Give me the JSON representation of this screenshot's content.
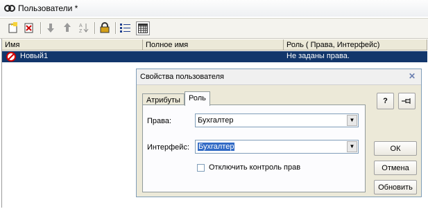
{
  "window": {
    "title": "Пользователи *"
  },
  "toolbar": {
    "icons": [
      "new-user-icon",
      "delete-user-icon",
      "move-down-icon",
      "move-up-icon",
      "sort-icon",
      "lock-icon",
      "list-view-icon",
      "table-view-icon"
    ]
  },
  "grid": {
    "columns": [
      "Имя",
      "Полное имя",
      "Роль ( Права, Интерфейс)"
    ],
    "rows": [
      {
        "name": "Новый1",
        "full_name": "",
        "role": "Не заданы права."
      }
    ]
  },
  "dialog": {
    "title": "Свойства пользователя",
    "tabs": [
      "Атрибуты",
      "Роль"
    ],
    "active_tab": "Роль",
    "rights_label": "Права:",
    "rights_value": "Бухгалтер",
    "interface_label": "Интерфейс:",
    "interface_value": "Бухгалтер",
    "disable_rights_control_label": "Отключить контроль прав",
    "disable_rights_control_checked": false,
    "help_button": "?",
    "ok_button": "ОК",
    "cancel_button": "Отмена",
    "refresh_button": "Обновить"
  },
  "colors": {
    "selection": "#12366b",
    "dialog_bg": "#ece9d8"
  }
}
